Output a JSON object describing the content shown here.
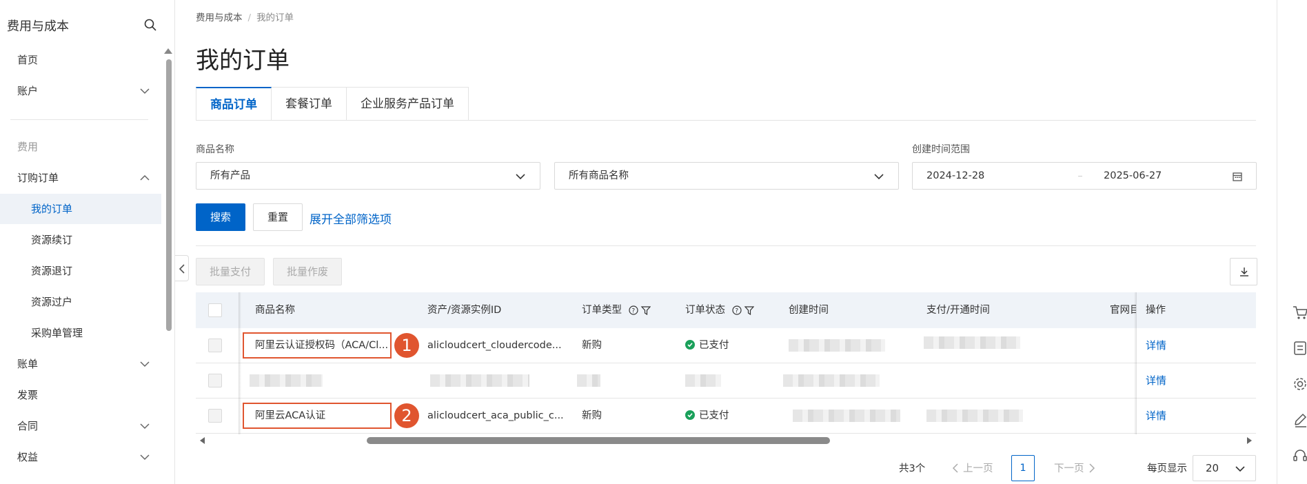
{
  "sidebar": {
    "title": "费用与成本",
    "items": [
      {
        "label": "首页"
      },
      {
        "label": "账户"
      },
      {
        "label": "费用"
      },
      {
        "label": "订购订单"
      },
      {
        "label": "我的订单"
      },
      {
        "label": "资源续订"
      },
      {
        "label": "资源退订"
      },
      {
        "label": "资源过户"
      },
      {
        "label": "采购单管理"
      },
      {
        "label": "账单"
      },
      {
        "label": "发票"
      },
      {
        "label": "合同"
      },
      {
        "label": "权益"
      }
    ]
  },
  "breadcrumb": {
    "root": "费用与成本",
    "sep": "/",
    "current": "我的订单"
  },
  "page_title": "我的订单",
  "tabs": [
    {
      "label": "商品订单",
      "active": true
    },
    {
      "label": "套餐订单",
      "active": false
    },
    {
      "label": "企业服务产品订单",
      "active": false
    }
  ],
  "filters": {
    "product_label": "商品名称",
    "product_select": "所有产品",
    "product_name_select": "所有商品名称",
    "date_label": "创建时间范围",
    "date_start": "2024-12-28",
    "date_end": "2025-06-27"
  },
  "actions": {
    "search": "搜索",
    "reset": "重置",
    "expand": "展开全部筛选项",
    "batch_pay": "批量支付",
    "batch_void": "批量作废"
  },
  "table": {
    "columns": [
      "商品名称",
      "资产/资源实例ID",
      "订单类型",
      "订单状态",
      "创建时间",
      "支付/开通时间",
      "官网目",
      "操作"
    ],
    "rows": [
      {
        "name": "阿里云认证授权码（ACA/Cl...",
        "instance": "alicloudcert_cloudercode...",
        "type": "新购",
        "status": "已支付",
        "op": "详情",
        "badge": "1"
      },
      {
        "name": "",
        "instance": "",
        "type": "",
        "status": "",
        "op": "详情",
        "badge": ""
      },
      {
        "name": "阿里云ACA认证",
        "instance": "alicloudcert_aca_public_c...",
        "type": "新购",
        "status": "已支付",
        "op": "详情",
        "badge": "2"
      }
    ]
  },
  "pagination": {
    "total": "共3个",
    "prev": "上一页",
    "page": "1",
    "next": "下一页",
    "per_page_label": "每页显示",
    "per_page": "20"
  },
  "colors": {
    "primary": "#0064c8",
    "highlight": "#e0552f",
    "success": "#1aa05a"
  }
}
